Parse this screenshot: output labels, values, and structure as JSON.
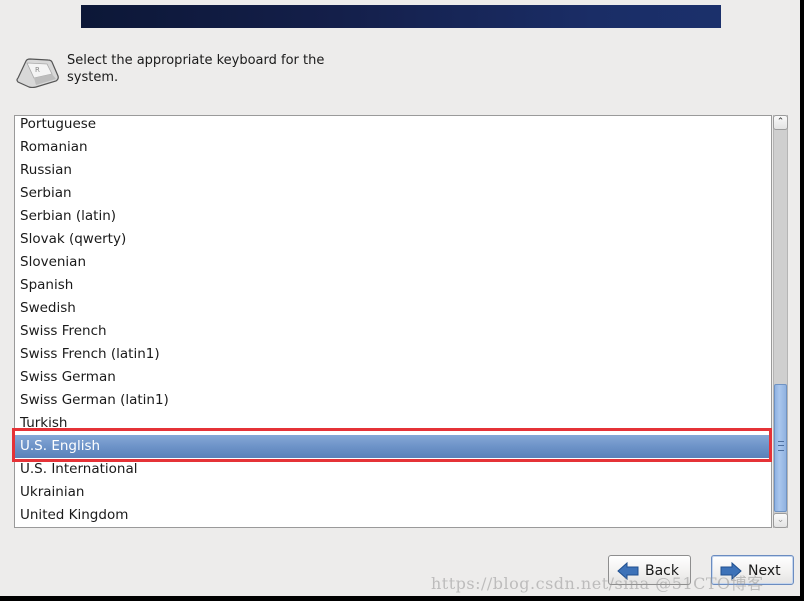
{
  "header": {
    "instruction": "Select the appropriate keyboard for the system.",
    "icon": "keyboard-key-icon"
  },
  "keyboard_list": {
    "items": [
      "Portuguese",
      "Romanian",
      "Russian",
      "Serbian",
      "Serbian (latin)",
      "Slovak (qwerty)",
      "Slovenian",
      "Spanish",
      "Swedish",
      "Swiss French",
      "Swiss French (latin1)",
      "Swiss German",
      "Swiss German (latin1)",
      "Turkish",
      "U.S. English",
      "U.S. International",
      "Ukrainian",
      "United Kingdom"
    ],
    "selected": "U.S. English",
    "selected_index": 14
  },
  "buttons": {
    "back_label": "Back",
    "next_label": "Next"
  },
  "colors": {
    "selection": "#6d93c8",
    "highlight_annotation": "#e53237",
    "banner": "#142050"
  },
  "watermark": "https://blog.csdn.net/sina @51CTO博客"
}
